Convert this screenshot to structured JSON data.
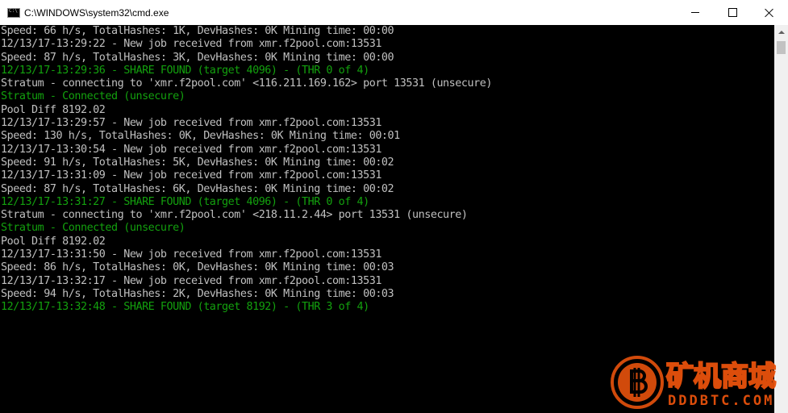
{
  "window": {
    "title": "C:\\WINDOWS\\system32\\cmd.exe",
    "icon": "cmd-icon"
  },
  "console": {
    "text_color": "#c0c0c0",
    "highlight_color": "#13a10e",
    "lines": [
      {
        "text": "Speed: 66 h/s, TotalHashes: 1K, DevHashes: 0K Mining time: 00:00",
        "color": "gray"
      },
      {
        "text": "12/13/17-13:29:22 - New job received from xmr.f2pool.com:13531",
        "color": "gray"
      },
      {
        "text": "Speed: 87 h/s, TotalHashes: 3K, DevHashes: 0K Mining time: 00:00",
        "color": "gray"
      },
      {
        "text": "12/13/17-13:29:36 - SHARE FOUND (target 4096) - (THR 0 of 4)",
        "color": "green"
      },
      {
        "text": "Stratum - connecting to 'xmr.f2pool.com' <116.211.169.162> port 13531 (unsecure)",
        "color": "gray"
      },
      {
        "text": "Stratum - Connected (unsecure)",
        "color": "green"
      },
      {
        "text": "Pool Diff 8192.02",
        "color": "gray"
      },
      {
        "text": "12/13/17-13:29:57 - New job received from xmr.f2pool.com:13531",
        "color": "gray"
      },
      {
        "text": "Speed: 130 h/s, TotalHashes: 0K, DevHashes: 0K Mining time: 00:01",
        "color": "gray"
      },
      {
        "text": "12/13/17-13:30:54 - New job received from xmr.f2pool.com:13531",
        "color": "gray"
      },
      {
        "text": "Speed: 91 h/s, TotalHashes: 5K, DevHashes: 0K Mining time: 00:02",
        "color": "gray"
      },
      {
        "text": "12/13/17-13:31:09 - New job received from xmr.f2pool.com:13531",
        "color": "gray"
      },
      {
        "text": "Speed: 87 h/s, TotalHashes: 6K, DevHashes: 0K Mining time: 00:02",
        "color": "gray"
      },
      {
        "text": "12/13/17-13:31:27 - SHARE FOUND (target 4096) - (THR 0 of 4)",
        "color": "green"
      },
      {
        "text": "Stratum - connecting to 'xmr.f2pool.com' <218.11.2.44> port 13531 (unsecure)",
        "color": "gray"
      },
      {
        "text": "Stratum - Connected (unsecure)",
        "color": "green"
      },
      {
        "text": "Pool Diff 8192.02",
        "color": "gray"
      },
      {
        "text": "12/13/17-13:31:50 - New job received from xmr.f2pool.com:13531",
        "color": "gray"
      },
      {
        "text": "Speed: 86 h/s, TotalHashes: 0K, DevHashes: 0K Mining time: 00:03",
        "color": "gray"
      },
      {
        "text": "12/13/17-13:32:17 - New job received from xmr.f2pool.com:13531",
        "color": "gray"
      },
      {
        "text": "Speed: 94 h/s, TotalHashes: 2K, DevHashes: 0K Mining time: 00:03",
        "color": "gray"
      },
      {
        "text": "12/13/17-13:32:48 - SHARE FOUND (target 8192) - (THR 3 of 4)",
        "color": "green"
      }
    ]
  },
  "watermark": {
    "title": "矿机商城",
    "subtitle": "DDDBTC.COM",
    "icon": "bitcoin-logo-icon",
    "color": "#e8520c"
  }
}
